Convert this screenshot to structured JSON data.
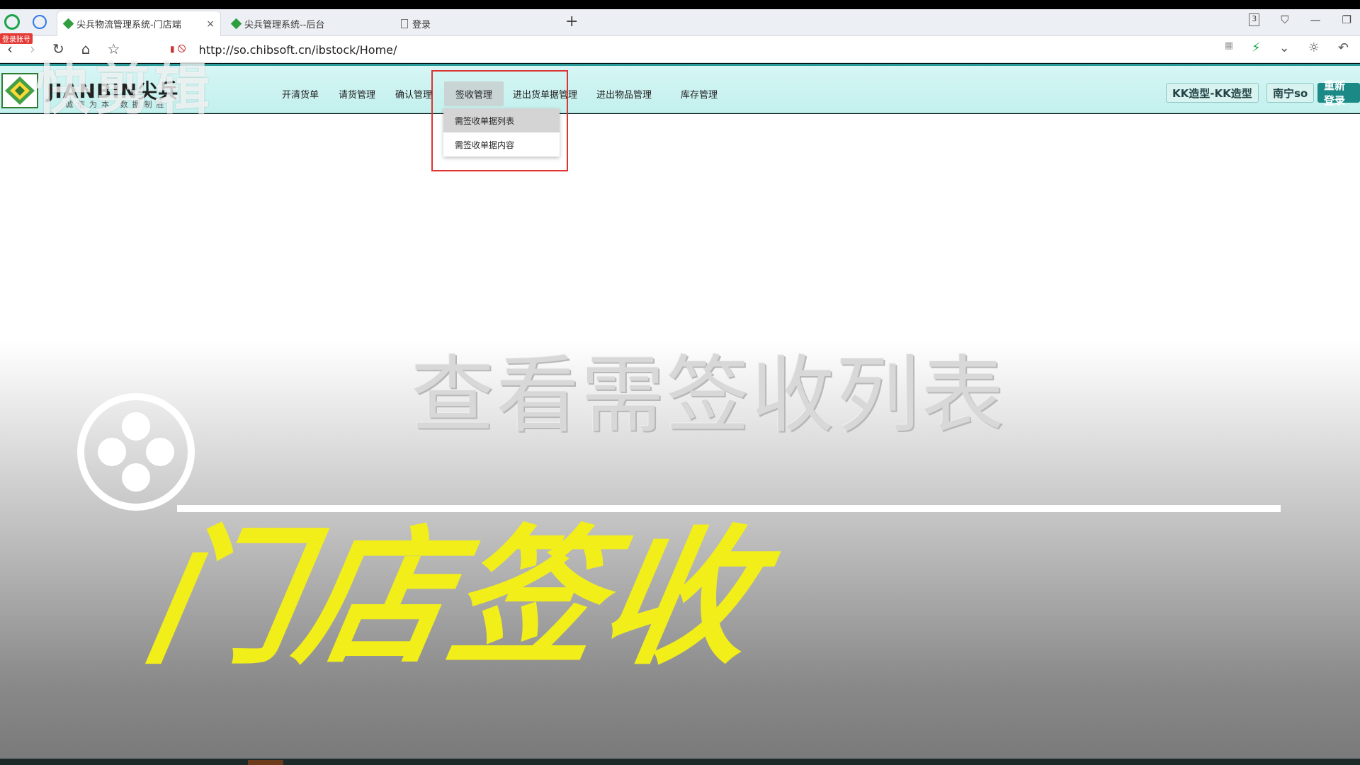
{
  "browser": {
    "tabs": [
      {
        "label": "尖兵物流管理系统-门店端",
        "active": true
      },
      {
        "label": "尖兵管理系统--后台",
        "active": false
      },
      {
        "label": "登录",
        "active": false
      }
    ],
    "new_tab": "+",
    "tab_close": "×",
    "tab_count_badge": "3",
    "url": "http://so.chibsoft.cn/ibstock/Home/",
    "red_badge": "登录账号"
  },
  "app": {
    "brand": "JIANBIN尖兵",
    "brand_sub": "诚信为本 数据制胜",
    "menu": [
      "开清货单",
      "请货管理",
      "确认管理",
      "签收管理",
      "进出货单据管理",
      "进出物品管理",
      "库存管理"
    ],
    "active_menu": "签收管理",
    "dropdown": [
      "需签收单据列表",
      "需签收单据内容"
    ],
    "buttons": {
      "store_type": "KK造型-KK造型",
      "user": "南宁so",
      "relogin": "重新登录"
    }
  },
  "overlay": {
    "watermark": "快剪辑",
    "subtitle": "查看需签收列表",
    "title": "门店签收"
  },
  "colors": {
    "header_bg": "#c8f2f0",
    "accent": "#1b8a86",
    "title_yellow": "#f2ee1a",
    "highlight_box": "#dd3333"
  }
}
